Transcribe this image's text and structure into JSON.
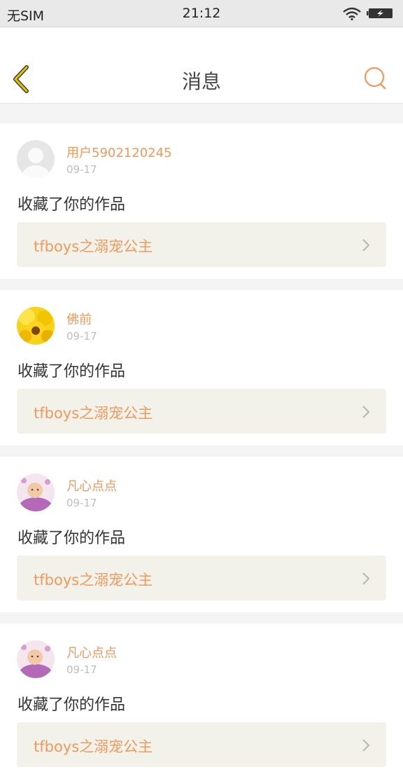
{
  "status_bar": {
    "carrier": "无SIM",
    "time": "21:12",
    "icons": [
      "wifi-icon",
      "battery-charging-icon"
    ]
  },
  "nav": {
    "title": "消息",
    "back_icon": "chevron-left-icon",
    "search_icon": "search-icon"
  },
  "colors": {
    "accent": "#f0995b",
    "back_icon": "#e8b400",
    "work_box_bg": "#f3f2ea"
  },
  "messages": [
    {
      "username": "用户5902120245",
      "date": "09-17",
      "action": "收藏了你的作品",
      "work_title": "tfboys之溺宠公主",
      "avatar": "default-avatar"
    },
    {
      "username": "佛前",
      "date": "09-17",
      "action": "收藏了你的作品",
      "work_title": "tfboys之溺宠公主",
      "avatar": "sunflower-avatar"
    },
    {
      "username": "凡心点点",
      "date": "09-17",
      "action": "收藏了你的作品",
      "work_title": "tfboys之溺宠公主",
      "avatar": "baby-avatar"
    },
    {
      "username": "凡心点点",
      "date": "09-17",
      "action": "收藏了你的作品",
      "work_title": "tfboys之溺宠公主",
      "avatar": "baby-avatar"
    }
  ]
}
